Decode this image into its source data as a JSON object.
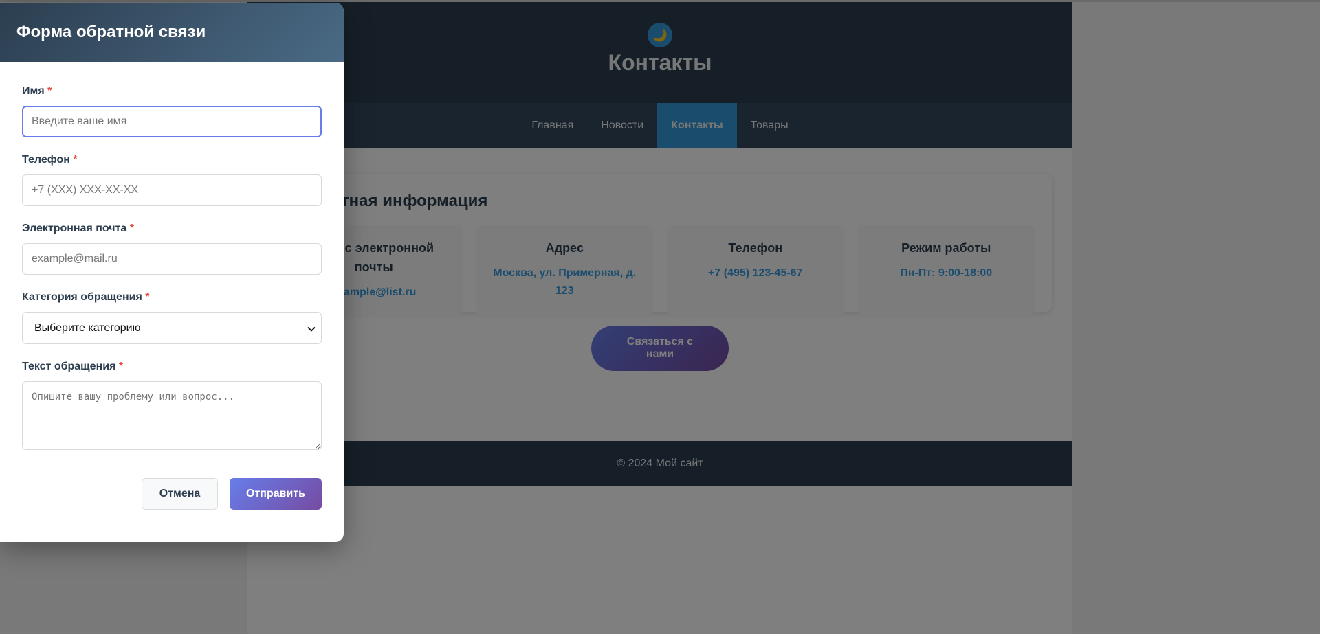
{
  "header": {
    "theme_icon": "🌙",
    "title": "Контакты"
  },
  "nav": {
    "items": [
      "Главная",
      "Новости",
      "Контакты",
      "Товары"
    ],
    "active": "Контакты"
  },
  "contact_info": {
    "title": "Контактная информация",
    "items": [
      {
        "title": "Адрес электронной почты",
        "value": "example@list.ru"
      },
      {
        "title": "Адрес",
        "value": "Москва, ул. Примерная, д. 123"
      },
      {
        "title": "Телефон",
        "value": "+7 (495) 123-45-67"
      },
      {
        "title": "Режим работы",
        "value": "Пн-Пт: 9:00-18:00"
      }
    ]
  },
  "contact_button": "Связаться с нами",
  "footer": "© 2024 Мой сайт",
  "modal": {
    "title": "Форма обратной связи",
    "required_mark": "*",
    "name": {
      "label": "Имя",
      "placeholder": "Введите ваше имя",
      "value": ""
    },
    "phone": {
      "label": "Телефон",
      "placeholder": "+7 (XXX) XXX-XX-XX",
      "value": ""
    },
    "email": {
      "label": "Электронная почта",
      "placeholder": "example@mail.ru",
      "value": ""
    },
    "category": {
      "label": "Категория обращения",
      "selected": "Выберите категорию"
    },
    "message": {
      "label": "Текст обращения",
      "placeholder": "Опишите вашу проблему или вопрос...",
      "value": ""
    },
    "cancel_label": "Отмена",
    "submit_label": "Отправить"
  },
  "colors": {
    "header_bg": "#2c3e50",
    "accent": "#3498db",
    "gradient_start": "#667eea",
    "gradient_end": "#764ba2",
    "required": "#e74c3c"
  },
  "icons": [
    "moon-icon",
    "chevron-down-icon"
  ]
}
